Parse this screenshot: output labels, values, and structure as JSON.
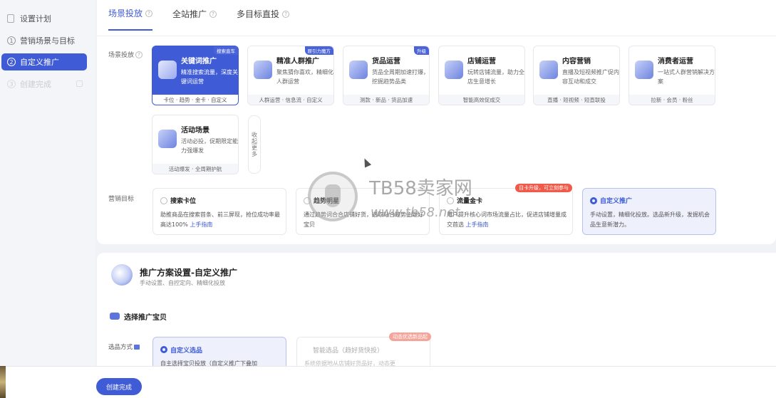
{
  "sidebar": {
    "items": [
      {
        "label": "设置计划",
        "num": ""
      },
      {
        "label": "营销场景与目标",
        "num": "1"
      },
      {
        "label": "自定义推广",
        "num": "2"
      },
      {
        "label": "创建完成",
        "num": "3"
      }
    ]
  },
  "tabs": [
    {
      "label": "场景投放"
    },
    {
      "label": "全站推广"
    },
    {
      "label": "多目标直投"
    }
  ],
  "scene_label": "场景投放",
  "scenes": [
    {
      "title": "关键词推广",
      "desc": "精准搜索流量，深度关键词运营",
      "foot": "卡位 · 趋势 · 金卡 · 自定义",
      "badge": "搜索直车"
    },
    {
      "title": "精准人群推广",
      "desc": "聚焦猜你喜欢，精细化人群运营",
      "foot": "人群运营 · 信息流 · 自定义",
      "badge": "原引力魔方"
    },
    {
      "title": "货品运营",
      "desc": "货品全周期加速打爆，挖掘趋势品类",
      "foot": "测款 · 新品 · 货品加速",
      "badge": "升级"
    },
    {
      "title": "店铺运营",
      "desc": "玩转店铺流量，助力全店生意增长",
      "foot": "智能高效促成交",
      "badge": ""
    },
    {
      "title": "内容营销",
      "desc": "直播及短视频推广促内容互动和成交",
      "foot": "直播 · 短视频 · 短直联投",
      "badge": ""
    },
    {
      "title": "消费者运营",
      "desc": "一站式人群营销解决方案",
      "foot": "拉新 · 会员 · 粉丝",
      "badge": ""
    },
    {
      "title": "活动场景",
      "desc": "活动必投，促期限定能力强爆发",
      "foot": "活动爆发 · 全周期护航",
      "badge": ""
    }
  ],
  "collapse_label": "收起更多",
  "goal_label": "营销目标",
  "goals": [
    {
      "title": "搜索卡位",
      "desc": "助推商品在搜索首条、前三屏现，抢位成功率最高达100%",
      "link": "上手指南"
    },
    {
      "title": "趋势明星",
      "desc": "通过趋势词合合店铺好货，选取站合趋势主题好宝贝",
      "link": ""
    },
    {
      "title": "流量金卡",
      "desc": "用户提升核心词市场流量占比，促进店铺增量成交首选",
      "link": "上手指南"
    },
    {
      "title": "自定义推广",
      "desc": "手动设置，精细化投放。选品新升级，发掘机会品生意新潜力。",
      "link": ""
    }
  ],
  "goal_badge": "目卡升级，可立刻参与",
  "plan": {
    "title": "推广方案设置-自定义推广",
    "subtitle": "手动设置、自控定向、精细化投放"
  },
  "select_item": {
    "title": "选择推广宝贝",
    "method_label": "选品方式",
    "options": [
      {
        "title": "自定义选品",
        "desc": "自主选择宝贝投放（自定义推广下叠加"
      },
      {
        "title": "智能选品（趋好货快投）",
        "desc": "系统依据地从店铺好货品好，动态更"
      }
    ],
    "badge": "动态优选新品起"
  },
  "footer": {
    "create_button": "创建完成"
  },
  "watermark": {
    "brand": "TB58卖家网",
    "url": "www.tb58.net"
  }
}
